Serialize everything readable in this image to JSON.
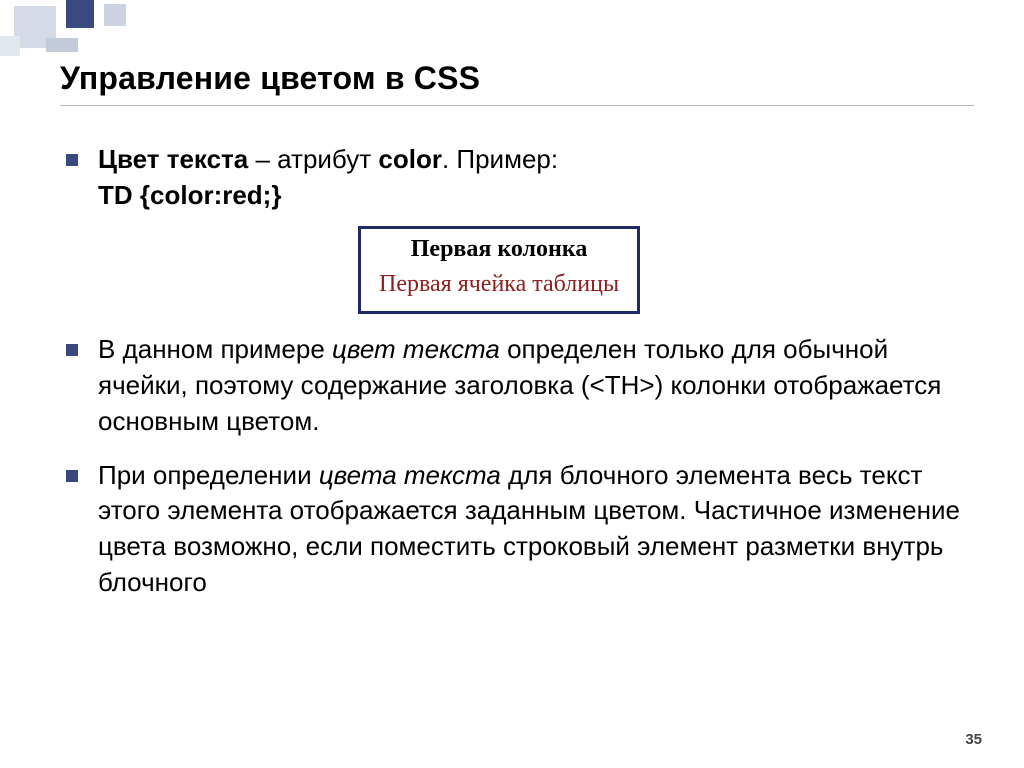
{
  "title": "Управление цветом в CSS",
  "bullet1": {
    "strong1": "Цвет текста",
    "rest1": " – атрибут ",
    "strong2": "color",
    "rest2": ". Пример:",
    "line2": "TD {color:red;}"
  },
  "tablebox": {
    "th": "Первая колонка",
    "td": "Первая ячейка таблицы"
  },
  "bullet2": {
    "t1": "В данном примере ",
    "it1": "цвет текста",
    "t2": " определен только для обычной ячейки, поэтому содержание заголовка (<TH>) колонки отображается основным цветом."
  },
  "bullet3": {
    "t1": "При определении ",
    "it1": "цвета текста",
    "t2": " для блочного элемента весь текст этого элемента отображается заданным цветом. Частичное изменение цвета возможно, если поместить строковый элемент разметки внутрь блочного"
  },
  "page_number": "35"
}
